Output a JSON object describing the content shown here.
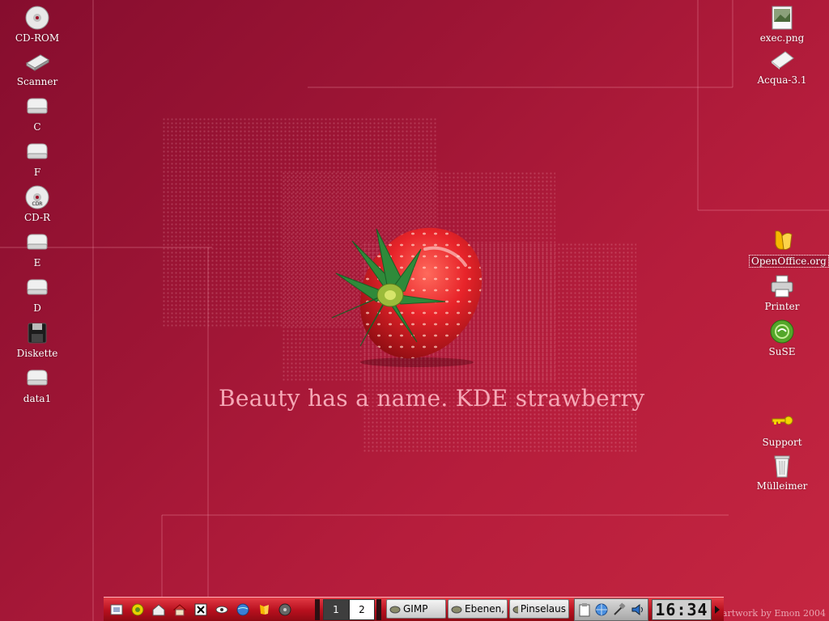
{
  "desktop": {
    "left_icons": [
      {
        "label": "CD-ROM",
        "icon": "cdrom-icon"
      },
      {
        "label": "Scanner",
        "icon": "scanner-icon"
      },
      {
        "label": "C",
        "icon": "harddisk-icon"
      },
      {
        "label": "F",
        "icon": "harddisk-icon"
      },
      {
        "label": "CD-R",
        "icon": "cdr-icon"
      },
      {
        "label": "E",
        "icon": "harddisk-icon"
      },
      {
        "label": "D",
        "icon": "harddisk-icon"
      },
      {
        "label": "Diskette",
        "icon": "floppy-icon"
      },
      {
        "label": "data1",
        "icon": "harddisk-icon"
      }
    ],
    "right_icons": [
      {
        "label": "exec.png",
        "icon": "image-file-icon"
      },
      {
        "label": "Acqua-3.1",
        "icon": "document-icon"
      },
      {
        "label": "OpenOffice.org",
        "icon": "openoffice-icon"
      },
      {
        "label": "Printer",
        "icon": "printer-icon"
      },
      {
        "label": "SuSE",
        "icon": "suse-icon"
      },
      {
        "label": "Support",
        "icon": "key-icon"
      },
      {
        "label": "Mülleimer",
        "icon": "trash-icon"
      }
    ]
  },
  "wallpaper": {
    "tagline": "Beauty has a name. KDE strawberry",
    "credit": "artwork by Emon 2004"
  },
  "taskbar": {
    "pager": [
      "1",
      "2"
    ],
    "active_desktop": "2",
    "tasks": [
      {
        "label": "GIMP"
      },
      {
        "label": "Ebenen,"
      },
      {
        "label": "Pinselaus"
      }
    ],
    "clock": "16:34"
  },
  "colors": {
    "wallpaper_dark": "#860d2e",
    "wallpaper_light": "#c52641",
    "taskbar_red": "#b8101e",
    "tagline": "#f5a8b6"
  }
}
